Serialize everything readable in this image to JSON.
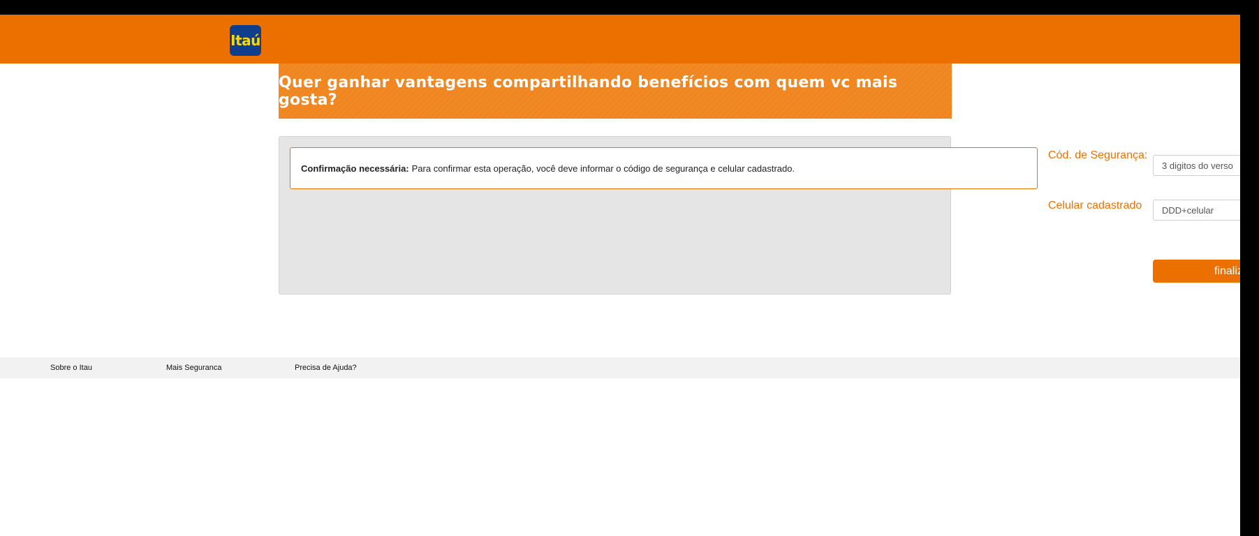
{
  "header": {
    "logo_text": "Itaú",
    "brand_color": "#ec7000",
    "logo_bg": "#0f3f8c"
  },
  "banner": {
    "text": "Quer ganhar vantagens compartilhando benefícios com quem vc mais gosta?"
  },
  "notice": {
    "bold": "Confirmação necessária:",
    "text": "Para confirmar esta operação, você deve informar o código de segurança e celular cadastrado."
  },
  "form": {
    "security_label": "Cód. de Segurança:",
    "security_placeholder": "3 digitos do verso",
    "phone_label": "Celular cadastrado",
    "phone_placeholder": "DDD+celular",
    "submit_label": "finalizar"
  },
  "footer": {
    "links": [
      "Sobre o Itau",
      "Mais Seguranca",
      "Precisa de Ajuda?"
    ]
  }
}
